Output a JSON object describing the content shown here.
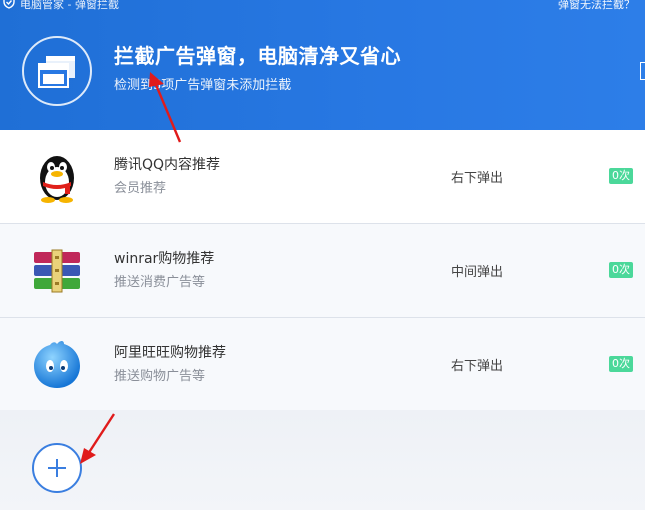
{
  "window": {
    "title": "电脑管家 - 弹窗拦截",
    "help_link": "弹窗无法拦截？"
  },
  "hero": {
    "title": "拦截广告弹窗，电脑清净又省心",
    "subtitle": "检测到3项广告弹窗未添加拦截"
  },
  "items": [
    {
      "name": "腾讯QQ内容推荐",
      "desc": "会员推荐",
      "position": "右下弹出",
      "count": "0次",
      "icon": "qq-penguin-icon"
    },
    {
      "name": "winrar购物推荐",
      "desc": "推送消费广告等",
      "position": "中间弹出",
      "count": "0次",
      "icon": "winrar-books-icon"
    },
    {
      "name": "阿里旺旺购物推荐",
      "desc": "推送购物广告等",
      "position": "右下弹出",
      "count": "0次",
      "icon": "aliwangwang-icon"
    }
  ],
  "colors": {
    "header_blue": "#2878e3",
    "count_badge": "#4bd89a",
    "annotation_arrow": "#e01b1b"
  }
}
